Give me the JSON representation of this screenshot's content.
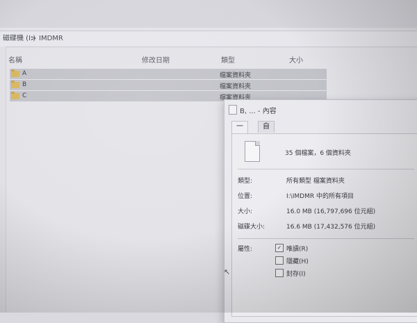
{
  "explorer": {
    "breadcrumb": [
      "磁碟機 (I:)",
      "IMDMR"
    ],
    "breadcrumb_sep": ">",
    "columns": [
      "名稱",
      "修改日期",
      "類型",
      "大小"
    ],
    "rows": [
      {
        "name": "A",
        "type": "檔案資料夾"
      },
      {
        "name": "B",
        "type": "檔案資料夾"
      },
      {
        "name": "C",
        "type": "檔案資料夾"
      }
    ]
  },
  "dialog": {
    "title": "B, ... - 內容",
    "tabs": [
      "一般",
      "自訂"
    ],
    "summary": "35 個檔案，6 個資料夾",
    "props": [
      {
        "label": "類型:",
        "value": "所有類型 檔案資料夾"
      },
      {
        "label": "位置:",
        "value": "I:\\IMDMR 中的所有項目"
      },
      {
        "label": "大小:",
        "value": "16.0 MB (16,797,696 位元組)"
      },
      {
        "label": "磁碟大小:",
        "value": "16.6 MB (17,432,576 位元組)"
      }
    ],
    "attributes_label": "屬性:",
    "attributes": [
      {
        "label": "唯讀(R)",
        "mark": "✓"
      },
      {
        "label": "隱藏(H)",
        "mark": ""
      },
      {
        "label": "封存(I)",
        "mark": ""
      }
    ]
  }
}
